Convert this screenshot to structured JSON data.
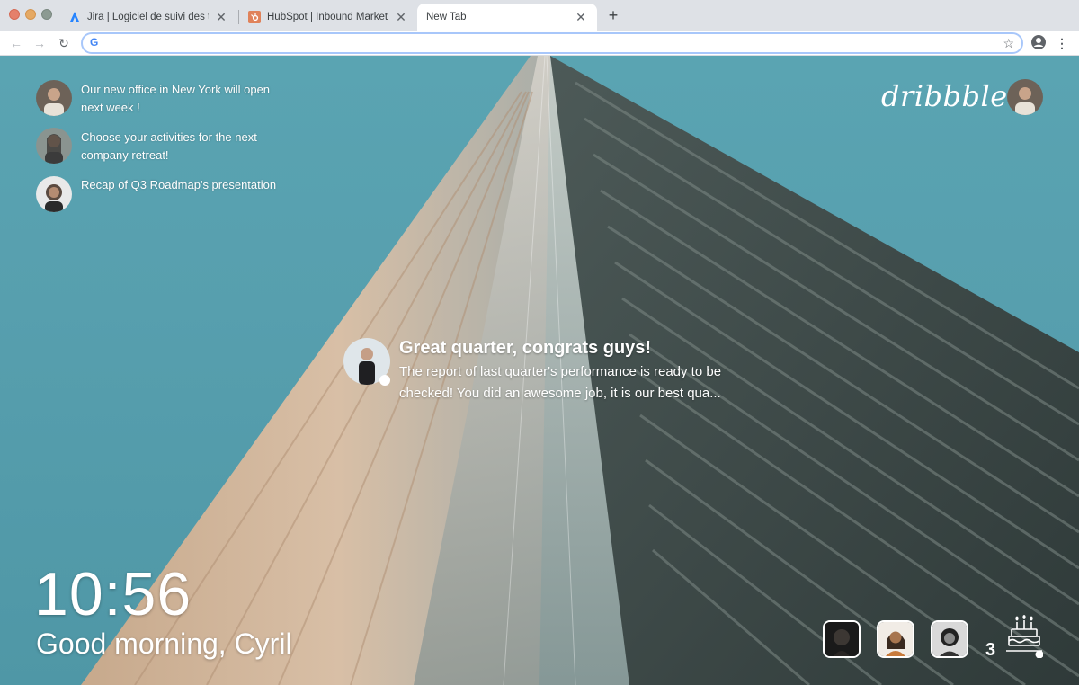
{
  "browser": {
    "tabs": [
      {
        "label": "Jira | Logiciel de suivi des tick",
        "favicon": "jira-icon"
      },
      {
        "label": "HubSpot | Inbound Marketing,",
        "favicon": "hubspot-icon"
      },
      {
        "label": "New Tab",
        "favicon": ""
      }
    ],
    "new_tab_glyph": "+",
    "close_glyph": "✕",
    "address_value": "",
    "search_engine_glyph": "G"
  },
  "news": [
    {
      "text": "Our new office in New York will open next week !"
    },
    {
      "text": "Choose your activities for the next company retreat!"
    },
    {
      "text": "Recap of Q3 Roadmap's presentation"
    }
  ],
  "brand": {
    "logo_text": "dribbble"
  },
  "notification": {
    "title": "Great quarter, congrats guys!",
    "body": "The report of last quarter's performance is ready to be checked! You did an awesome job, it is our best qua..."
  },
  "clock": {
    "time": "10:56",
    "greeting": "Good morning, Cyril"
  },
  "birthdays": {
    "count": "3"
  },
  "colors": {
    "accent": "#a8c7fa",
    "sky": "#5aa4b2"
  }
}
